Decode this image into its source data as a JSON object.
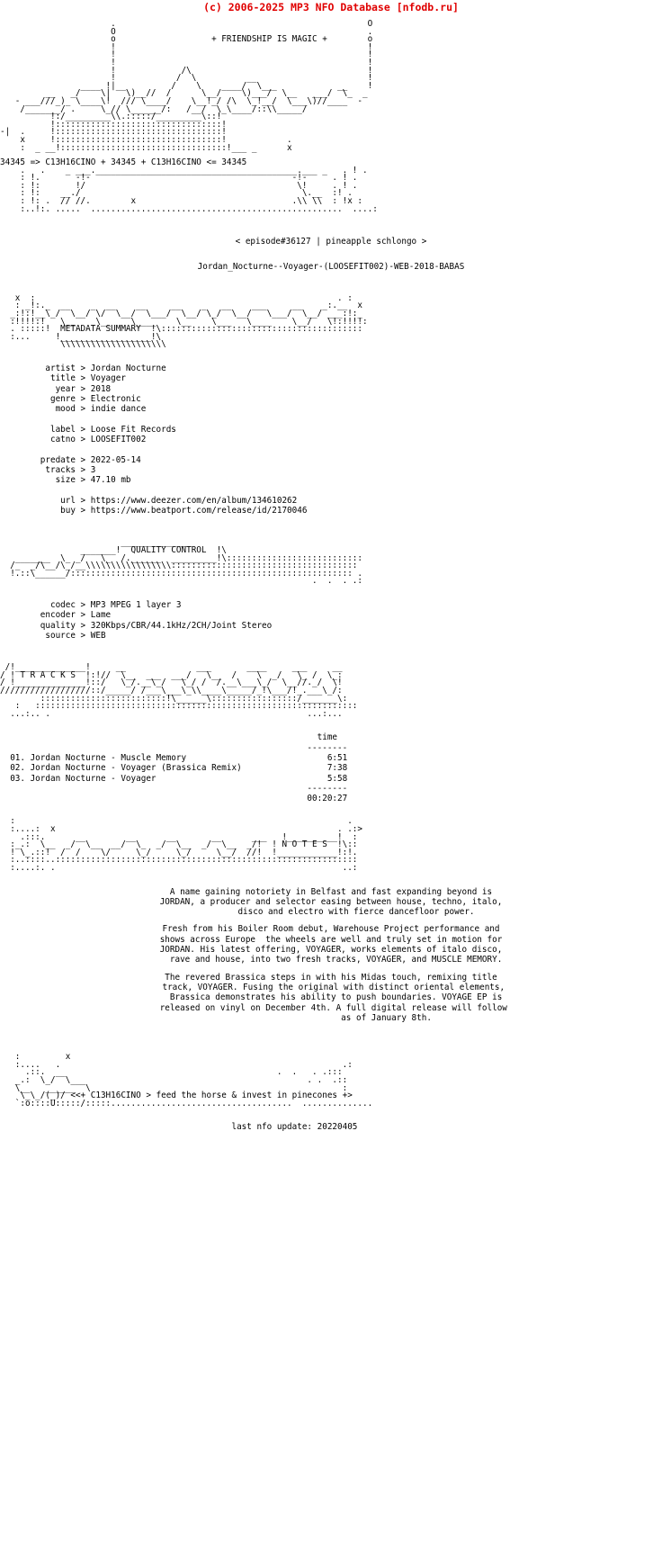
{
  "header": {
    "copyright": "(c) 2006-2025 MP3 NFO Database [nfodb.ru]",
    "color": "#e00000"
  },
  "banner": {
    "tagline": "+ FRIENDSHIP IS MAGIC +",
    "formula_line": "34345 => C13H16CINO + 34345 + C13H16CINO <= 34345",
    "episode_line": "< episode#36127 | pineapple schlongo >",
    "release_name": "Jordan_Nocturne--Voyager-(LOOSEFIT002)-WEB-2018-BABAS",
    "art_top": "                      .                                                  O\n                      O                                                  .\n                      o                   + FRIENDSHIP IS MAGIC +        o\n                      !                                                  !\n                      !                                                  !\n                      !                                                  !\n                      !                     /\\                           !\n     _  ___/// \\______/!__/)__//    _\\___/)__/ \\\\     !__/    /__  _\n  -  ___///_)___ \\/!_ //  \\_____\\/!_/ /  / \\\\_!_/ \\_)___///___ -\n    /______/ .  \\______/: /_ \\___\\::/______/\\\n          !:/________\\\\.:::::/________\\::!\n   .      !:::::::::::::::::::::::::::::::!\n-|        !:::::::::::::::::::::::::::::::!           .\n    x     !:::::::::::::::::::::::::::::::!\n    :   _ ___!:::::::::::::::::::::::::::::::!___ _        x",
    "art_mid": "    .                                                          .\n    .   .    34345 => C13H16CINO + 34345 + C13H16CINO <= 34345  .\n    .   .   _ ___.___________________________________.___ _   . ! .\n    : !.      -!-                                 -!      . ! .\n    : !:      !/                                  \\!      :! .\n    : !:   __./                                    \\.__   :! .\n    : !: . // //.         x                      .\\\\ \\\\   : !x :\n    :..!:. .....  ..........................................  ...  ....:"
  },
  "metadata": {
    "section_title": "METADATA SUMMARY",
    "fields": [
      {
        "key": "artist",
        "value": "Jordan Nocturne"
      },
      {
        "key": "title",
        "value": "Voyager"
      },
      {
        "key": "year",
        "value": "2018"
      },
      {
        "key": "genre",
        "value": "Electronic"
      },
      {
        "key": "mood",
        "value": "indie dance"
      }
    ],
    "fields2": [
      {
        "key": "label",
        "value": "Loose Fit Records"
      },
      {
        "key": "catno",
        "value": "LOOSEFIT002"
      }
    ],
    "fields3": [
      {
        "key": "predate",
        "value": "2022-05-14"
      },
      {
        "key": "tracks",
        "value": "3"
      },
      {
        "key": "size",
        "value": "47.10 mb"
      }
    ],
    "fields4": [
      {
        "key": "url",
        "value": "https://www.deezer.com/en/album/134610262"
      },
      {
        "key": "buy",
        "value": "https://www.beatport.com/release/id/2170046"
      }
    ],
    "block": "         artist > Jordan Nocturne\n          title > Voyager\n           year > 2018\n          genre > Electronic\n           mood > indie dance\n\n          label > Loose Fit Records\n          catno > LOOSEFIT002\n\n        predate > 2022-05-14\n         tracks > 3\n           size > 47.10 mb\n\n            url > https://www.deezer.com/en/album/134610262\n            buy > https://www.beatport.com/release/id/2170046"
  },
  "quality": {
    "section_title": "QUALITY CONTROL",
    "fields": [
      {
        "key": "codec",
        "value": "MP3 MPEG 1 layer 3"
      },
      {
        "key": "encoder",
        "value": "Lame"
      },
      {
        "key": "quality",
        "value": "320Kbps/CBR/44.1kHz/2CH/Joint Stereo"
      },
      {
        "key": "source",
        "value": "WEB"
      }
    ],
    "block": "          codec > MP3 MPEG 1 layer 3\n        encoder > Lame\n        quality > 320Kbps/CBR/44.1kHz/2CH/Joint Stereo\n         source > WEB"
  },
  "tracks": {
    "section_title": "T R A C K S",
    "time_header": "time",
    "time_rule": "--------",
    "items": [
      {
        "num": "01.",
        "artist": "Jordan Nocturne",
        "title": "Muscle Memory",
        "time": "6:51"
      },
      {
        "num": "02.",
        "artist": "Jordan Nocturne",
        "title": "Voyager (Brassica Remix)",
        "time": "7:38"
      },
      {
        "num": "03.",
        "artist": "Jordan Nocturne",
        "title": "Voyager",
        "time": "5:58"
      }
    ],
    "total": "00:20:27",
    "block": "  01. Jordan Nocturne - Muscle Memory                            6:51\n  02. Jordan Nocturne - Voyager (Brassica Remix)                 7:38\n  03. Jordan Nocturne - Voyager                                  5:58"
  },
  "notes": {
    "section_title": "N O T E S",
    "paragraphs": [
      "A name gaining notoriety in Belfast and fast expanding beyond is\nJORDAN, a producer and selector easing between house, techno, italo,\n          disco and electro with fierce dancefloor power.",
      "Fresh from his Boiler Room debut, Warehouse Project performance and\nshows across Europe  the wheels are well and truly set in motion for\nJORDAN. His latest offering, VOYAGER, works elements of italo disco,\n  rave and house, into two fresh tracks, VOYAGER, and MUSCLE MEMORY.",
      "The revered Brassica steps in with his Midas touch, remixing title\n track, VOYAGER. Fusing the original with distinct oriental elements,\n  Brassica demonstrates his ability to push boundaries. VOYAGE EP is\n released on vinyl on December 4th. A full digital release will follow\n                      as of January 8th."
    ]
  },
  "footer": {
    "slogan": "<(+ C13H16CINO > feed the horse & invest in pinecones +)",
    "last_update_label": "last nfo update:",
    "last_update_value": "20220405",
    "last_update_line": "last nfo update: 20220405"
  }
}
